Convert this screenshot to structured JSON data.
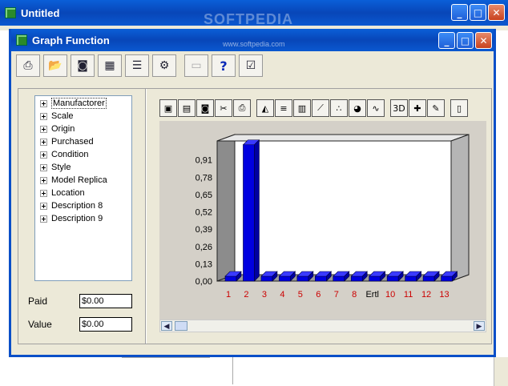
{
  "outer_window": {
    "title": "Untitled",
    "watermark": "SOFTPEDIA"
  },
  "dialog": {
    "title": "Graph Function",
    "url": "www.softpedia.com"
  },
  "toolbar": {
    "icons": [
      "printer-icon",
      "open-folder-icon",
      "camera-icon",
      "grid-icon",
      "list-icon",
      "settings-icon",
      "save-icon",
      "help-icon",
      "check-icon"
    ],
    "help_label": "?"
  },
  "tree": {
    "items": [
      "Manufactorer",
      "Scale",
      "Origin",
      "Purchased",
      "Condition",
      "Style",
      "Model Replica",
      "Location",
      "Description 8",
      "Description 9"
    ]
  },
  "fields": {
    "paid_label": "Paid",
    "paid_value": "$0.00",
    "value_label": "Value",
    "value_value": "$0.00"
  },
  "chart_data": {
    "type": "bar",
    "categories": [
      "1",
      "2",
      "3",
      "4",
      "5",
      "6",
      "7",
      "8",
      "Ertl",
      "10",
      "11",
      "12",
      "13"
    ],
    "values": [
      0,
      1,
      0,
      0,
      0,
      0,
      0,
      0,
      0,
      0,
      0,
      0,
      0
    ],
    "ylim": [
      0,
      1
    ],
    "yticks": [
      "0,00",
      "0,13",
      "0,26",
      "0,39",
      "0,52",
      "0,65",
      "0,78",
      "0,91"
    ],
    "bar_color": "#0000e0",
    "label_color": "#cc0000",
    "title": "",
    "xlabel": "",
    "ylabel": ""
  }
}
